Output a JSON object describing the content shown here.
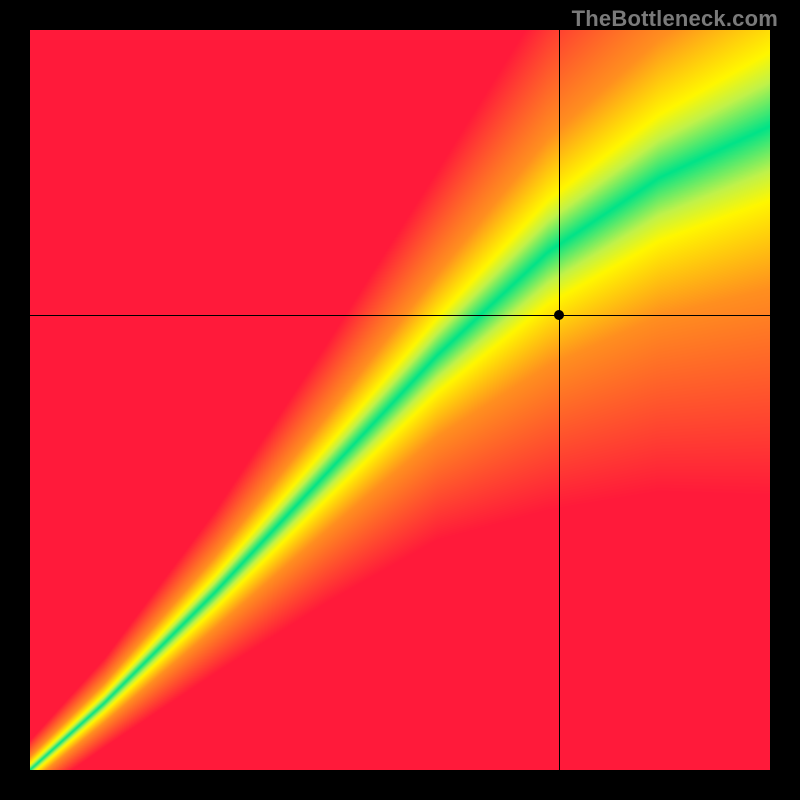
{
  "watermark": "TheBottleneck.com",
  "colors": {
    "red": "#ff1a3a",
    "orange": "#ff8f1f",
    "yellow": "#fff700",
    "yellowgreen": "#c0f24a",
    "green": "#00e388",
    "background": "#000000"
  },
  "crosshair": {
    "x_fraction": 0.715,
    "y_fraction": 0.385
  },
  "chart_data": {
    "type": "heatmap",
    "title": "",
    "xlabel": "",
    "ylabel": "",
    "x_range": [
      0,
      1
    ],
    "y_range": [
      0,
      1
    ],
    "description": "Bottleneck heatmap. A diagonal green optimal band runs from bottom-left to top-right, widening toward the top. Surrounding the band are yellow then orange then red regions indicating increasing bottleneck. A crosshair marks a single evaluated point near the upper-right, just right/below the green band on the yellow fringe.",
    "optimal_band": {
      "control_points_x": [
        0.0,
        0.1,
        0.25,
        0.4,
        0.55,
        0.7,
        0.85,
        1.0
      ],
      "center_y": [
        0.0,
        0.09,
        0.24,
        0.4,
        0.56,
        0.7,
        0.8,
        0.87
      ],
      "half_width_y": [
        0.008,
        0.012,
        0.022,
        0.035,
        0.05,
        0.07,
        0.085,
        0.1
      ]
    },
    "crosshair_point": {
      "x": 0.715,
      "y": 0.615
    },
    "color_stops": [
      {
        "dist": 0.0,
        "color": "#00e388"
      },
      {
        "dist": 0.6,
        "color": "#c0f24a"
      },
      {
        "dist": 1.0,
        "color": "#fff700"
      },
      {
        "dist": 2.2,
        "color": "#ff8f1f"
      },
      {
        "dist": 5.0,
        "color": "#ff1a3a"
      }
    ],
    "legend": []
  }
}
